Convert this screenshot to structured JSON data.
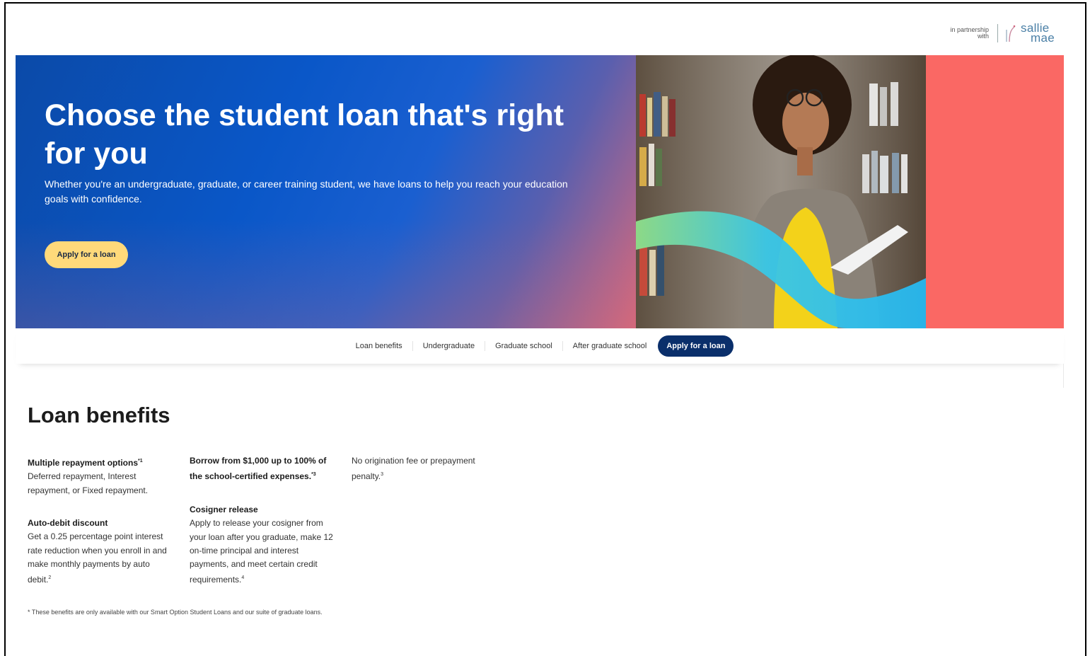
{
  "partner": {
    "line1": "in partnership",
    "line2": "with",
    "brand_line1": "sallie",
    "brand_line2": "mae"
  },
  "hero": {
    "title": "Choose the student loan that's right for you",
    "subtitle": "Whether you're an undergraduate, graduate, or career training student, we have loans to help you reach your education goals with confidence.",
    "cta": "Apply for a loan"
  },
  "tabs": {
    "items": [
      {
        "label": "Loan benefits"
      },
      {
        "label": "Undergraduate"
      },
      {
        "label": "Graduate school"
      },
      {
        "label": "After graduate school"
      }
    ],
    "cta": "Apply for a loan"
  },
  "benefits": {
    "title": "Loan benefits",
    "items": [
      {
        "heading": "Multiple repayment options",
        "mark": "*1",
        "body": "Deferred repayment, Interest repayment, or Fixed repayment."
      },
      {
        "heading": "Auto-debit discount",
        "mark": "",
        "body": "Get a 0.25 percentage point interest rate reduction when you enroll in and make monthly payments by auto debit.",
        "body_mark": "2"
      },
      {
        "heading": "Borrow from $1,000 up to 100% of the school-certified expenses.",
        "mark": "*3",
        "body": ""
      },
      {
        "heading": "Cosigner release",
        "mark": "",
        "body": "Apply to release your cosigner from your loan after you graduate, make 12 on-time principal and interest payments, and meet certain credit requirements.",
        "body_mark": "4"
      },
      {
        "heading": "",
        "mark": "",
        "body": "No origination fee or prepayment penalty.",
        "body_mark": "3"
      }
    ],
    "footnote": "* These benefits are only available with our Smart Option Student Loans and our suite of graduate loans."
  },
  "colors": {
    "hero_blue": "#0a57c8",
    "coral": "#fa6864",
    "cta_yellow": "#ffd97a",
    "nav_button": "#0a2f6b"
  }
}
